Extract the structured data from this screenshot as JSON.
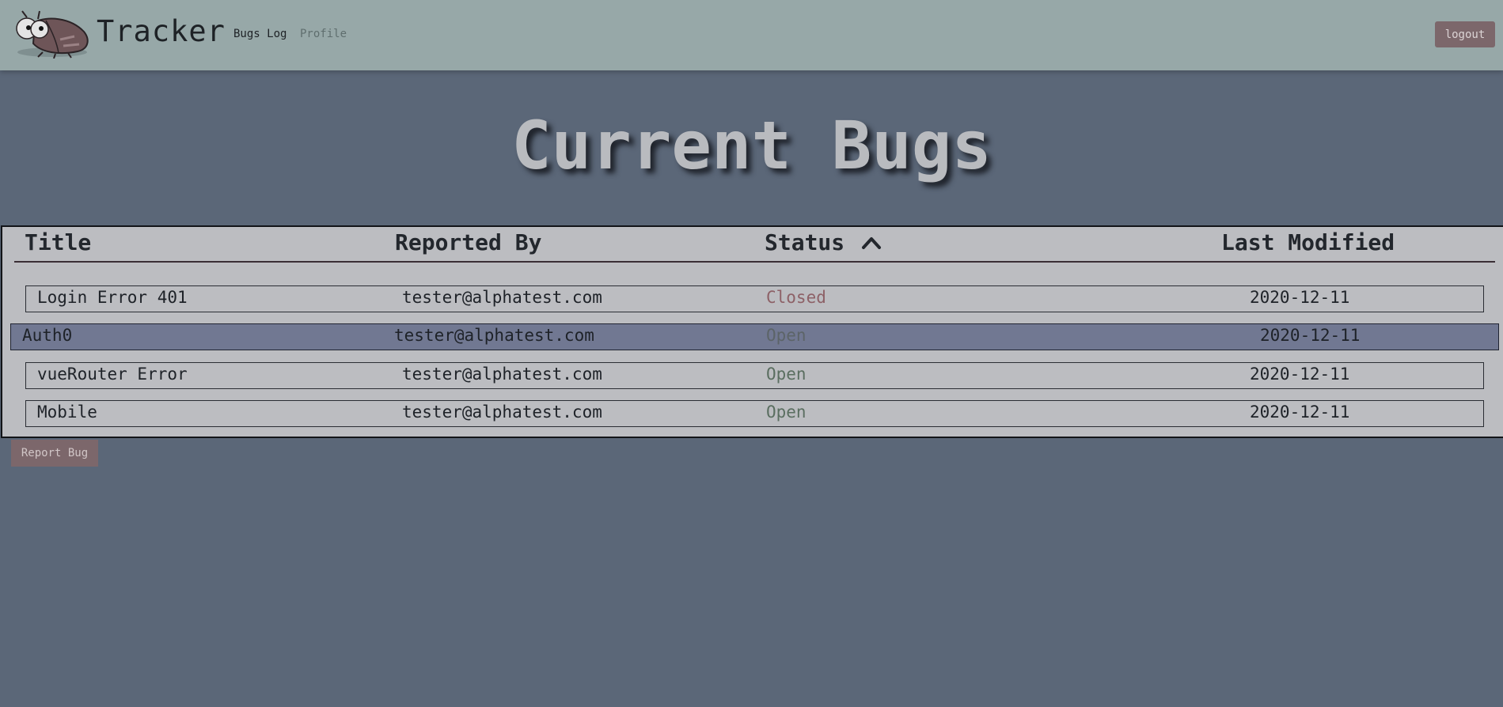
{
  "navbar": {
    "brand": "Tracker",
    "links": [
      {
        "label": "Bugs Log"
      },
      {
        "label": "Profile"
      }
    ],
    "logout_label": "logout"
  },
  "page": {
    "title": "Current Bugs"
  },
  "table": {
    "columns": [
      "Title",
      "Reported By",
      "Status",
      "Last Modified"
    ],
    "sort": {
      "column": "Status",
      "direction": "ascending",
      "icon": "chevron-up-icon"
    },
    "rows": [
      {
        "title": "Login Error 401",
        "reported_by": "tester@alphatest.com",
        "status": "Closed",
        "last_modified": "2020-12-11"
      },
      {
        "title": "Auth0",
        "reported_by": "tester@alphatest.com",
        "status": "Open",
        "last_modified": "2020-12-11"
      },
      {
        "title": "vueRouter Error",
        "reported_by": "tester@alphatest.com",
        "status": "Open",
        "last_modified": "2020-12-11"
      },
      {
        "title": "Mobile",
        "reported_by": "tester@alphatest.com",
        "status": "Open",
        "last_modified": "2020-12-11"
      }
    ]
  },
  "actions": {
    "report_label": "Report Bug"
  },
  "colors": {
    "navbar_bg": "#97a8a8",
    "page_bg": "#5b6778",
    "table_bg": "#bcbdc1",
    "status_closed": "#8d6167",
    "status_open": "#5a6e60",
    "status_open_hover": "#5c6468",
    "button_bg": "#7c676b",
    "row_hover_bg": "#717892"
  }
}
